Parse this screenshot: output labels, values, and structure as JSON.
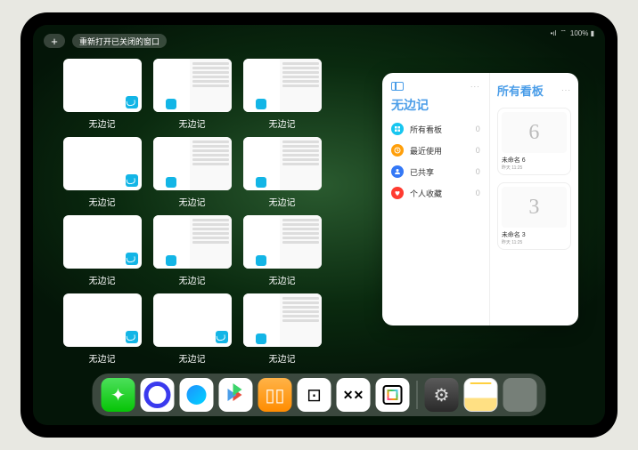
{
  "status": {
    "signal": "•ıl",
    "wifi": "⌔",
    "battery": "100% ▮"
  },
  "top": {
    "plus": "+",
    "reopen_label": "重新打开已关闭的窗口"
  },
  "app_switcher": {
    "app_name": "无边记",
    "windows": [
      {
        "type": "empty"
      },
      {
        "type": "split"
      },
      {
        "type": "split"
      },
      {
        "type": "empty"
      },
      {
        "type": "split"
      },
      {
        "type": "split"
      },
      {
        "type": "empty"
      },
      {
        "type": "split"
      },
      {
        "type": "split"
      },
      {
        "type": "empty"
      },
      {
        "type": "empty"
      },
      {
        "type": "split"
      }
    ]
  },
  "panel": {
    "title": "无边记",
    "right_title": "所有看板",
    "ellipsis": "···",
    "categories": [
      {
        "label": "所有看板",
        "count": 0,
        "color": "#18c6f0",
        "icon": "grid"
      },
      {
        "label": "最近使用",
        "count": 0,
        "color": "#ff9f0a",
        "icon": "clock"
      },
      {
        "label": "已共享",
        "count": 0,
        "color": "#3478f6",
        "icon": "person"
      },
      {
        "label": "个人收藏",
        "count": 0,
        "color": "#ff3b30",
        "icon": "heart"
      }
    ],
    "boards": [
      {
        "glyph": "6",
        "name": "未命名 6",
        "date": "昨天 11:25"
      },
      {
        "glyph": "3",
        "name": "未命名 3",
        "date": "昨天 11:25"
      }
    ]
  },
  "dock": {
    "apps": [
      {
        "name": "wechat",
        "glyph": "✦"
      },
      {
        "name": "quark",
        "glyph": ""
      },
      {
        "name": "qq-browser",
        "glyph": ""
      },
      {
        "name": "play-store",
        "glyph": ""
      },
      {
        "name": "books",
        "glyph": "▯▯"
      },
      {
        "name": "dice",
        "glyph": "⊡"
      },
      {
        "name": "bilibili",
        "glyph": "✕✕"
      },
      {
        "name": "freeform",
        "glyph": ""
      },
      {
        "name": "settings",
        "glyph": "⚙"
      },
      {
        "name": "notes",
        "glyph": ""
      },
      {
        "name": "app-folder",
        "glyph": ""
      }
    ]
  }
}
